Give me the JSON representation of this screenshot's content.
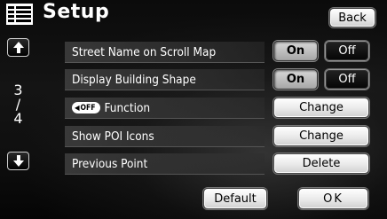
{
  "header": {
    "title": "Setup",
    "back_label": "Back"
  },
  "pager": {
    "page_current": "3",
    "page_separator": "/",
    "page_total": "4"
  },
  "rows": [
    {
      "label": "Street Name on Scroll Map",
      "on_label": "On",
      "off_label": "Off",
      "selected": "On"
    },
    {
      "label": "Display Building Shape",
      "on_label": "On",
      "off_label": "Off",
      "selected": "On"
    },
    {
      "badge": "OFF",
      "label": "Function",
      "action_label": "Change"
    },
    {
      "label": "Show POI Icons",
      "action_label": "Change"
    },
    {
      "label": "Previous Point",
      "action_label": "Delete"
    }
  ],
  "footer": {
    "default_label": "Default",
    "ok_label": "OK"
  },
  "icons": {
    "menu": "list-menu-icon",
    "page_up": "up-arrow-icon",
    "page_down": "down-arrow-icon",
    "badge": "left-triangle-icon"
  }
}
